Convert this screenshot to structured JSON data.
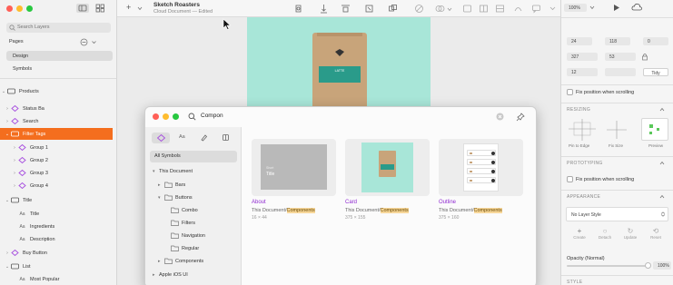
{
  "window": {
    "title": "Sketch Roasters",
    "subtitle": "Cloud Document — Edited"
  },
  "sidebar": {
    "search_placeholder": "Search Layers",
    "pages_label": "Pages",
    "pages": [
      {
        "label": "Design",
        "selected": true
      },
      {
        "label": "Symbols",
        "selected": false
      }
    ],
    "layers": [
      {
        "label": "Products",
        "type": "group",
        "indent": 0,
        "expanded": true
      },
      {
        "label": "Status Ba",
        "type": "symbol",
        "indent": 1
      },
      {
        "label": "Search",
        "type": "symbol",
        "indent": 1
      },
      {
        "label": "Filter Tags",
        "type": "group",
        "indent": 1,
        "selected": true,
        "expanded": true
      },
      {
        "label": "Group 1",
        "type": "symbol",
        "indent": 2
      },
      {
        "label": "Group 2",
        "type": "symbol",
        "indent": 2
      },
      {
        "label": "Group 3",
        "type": "symbol",
        "indent": 2
      },
      {
        "label": "Group 4",
        "type": "symbol",
        "indent": 2
      },
      {
        "label": "Title",
        "type": "group",
        "indent": 1,
        "expanded": true
      },
      {
        "label": "Title",
        "type": "text",
        "indent": 2
      },
      {
        "label": "Ingredients",
        "type": "text",
        "indent": 2
      },
      {
        "label": "Description",
        "type": "text",
        "indent": 2
      },
      {
        "label": "Buy Button",
        "type": "symbol",
        "indent": 1
      },
      {
        "label": "List",
        "type": "group",
        "indent": 1,
        "expanded": true
      },
      {
        "label": "Most Popular",
        "type": "text",
        "indent": 2
      }
    ]
  },
  "toolbar": {
    "insert_label": "+",
    "zoom": "100%"
  },
  "inspector": {
    "x": "24",
    "y": "118",
    "rotate": "0",
    "w": "327",
    "h": "53",
    "radius": "12",
    "tidy_label": "Tidy",
    "fix_position_label": "Fix position when scrolling",
    "resizing_label": "RESIZING",
    "resize_options": [
      "Pin to Edge",
      "Fix Size",
      "Preview"
    ],
    "prototyping_label": "PROTOTYPING",
    "fix_position_label2": "Fix position when scrolling",
    "appearance_label": "APPEARANCE",
    "layer_style_label": "No Layer Style",
    "appearance_actions": [
      "Create",
      "Detach",
      "Update",
      "Reset"
    ],
    "opacity_label": "Opacity (Normal)",
    "opacity_value": "100%",
    "style_label": "STYLE"
  },
  "popup": {
    "search_value": "Compon",
    "nav_items": [
      {
        "label": "All Symbols",
        "selected": true
      },
      {
        "label": "This Document",
        "indent": 0,
        "expanded": true
      },
      {
        "label": "Bars",
        "indent": 1,
        "expanded": false
      },
      {
        "label": "Buttons",
        "indent": 1,
        "expanded": true
      },
      {
        "label": "Combo",
        "indent": 2
      },
      {
        "label": "Filters",
        "indent": 2
      },
      {
        "label": "Navigation",
        "indent": 2
      },
      {
        "label": "Regular",
        "indent": 2
      },
      {
        "label": "Components",
        "indent": 1,
        "expanded": false
      },
      {
        "label": "Apple iOS UI",
        "indent": 0,
        "expanded": false
      }
    ],
    "cards": [
      {
        "name": "About",
        "path_prefix": "This Document/",
        "path_highlight": "Components",
        "size": "16 × 44"
      },
      {
        "name": "Card",
        "path_prefix": "This Document/",
        "path_highlight": "Components",
        "size": "375 × 155"
      },
      {
        "name": "Outline",
        "path_prefix": "This Document/",
        "path_highlight": "Components",
        "size": "375 × 160"
      }
    ],
    "card1_preview_text": [
      "Short",
      "Title"
    ],
    "card2_badge": "LATTE"
  },
  "artboard": {
    "badge": "LATTE"
  },
  "colors": {
    "accent": "#f46e1e",
    "symbol": "#a64ddf",
    "artboard_bg": "#a8e6d8",
    "teal": "#2a9b8a",
    "kraft": "#c8a47a"
  }
}
